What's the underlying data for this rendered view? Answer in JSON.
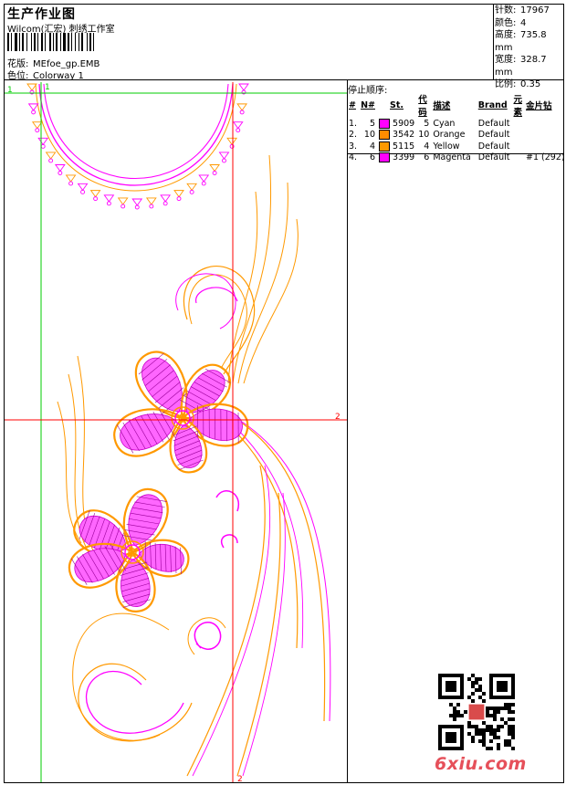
{
  "header": {
    "title": "生产作业图",
    "company": "Wilcom(汇宏) 刺绣工作室"
  },
  "design_info": {
    "name_label": "花版:",
    "name_value": "MEfoe_gp.EMB",
    "colorway_label": "色位:",
    "colorway_value": "Colorway 1"
  },
  "stats": {
    "stitches_label": "针数:",
    "stitches_value": "17967",
    "colors_label": "颜色:",
    "colors_value": "4",
    "height_label": "高度:",
    "height_value": "735.8 mm",
    "width_label": "宽度:",
    "width_value": "328.7 mm",
    "scale_label": "比例:",
    "scale_value": "0.35"
  },
  "stop_sequence": {
    "title": "停止顺序:",
    "headers": [
      "#",
      "N#",
      "St.",
      "代码",
      "描述",
      "Brand",
      "元素",
      "金片钻"
    ],
    "rows": [
      {
        "idx": "1.",
        "n": "5",
        "color": "#ff00ff",
        "st": "5909",
        "code": "5",
        "desc": "Cyan",
        "brand": "Default",
        "elem": "",
        "seq": ""
      },
      {
        "idx": "2.",
        "n": "10",
        "color": "#ff8c00",
        "st": "3542",
        "code": "10",
        "desc": "Orange",
        "brand": "Default",
        "elem": "",
        "seq": ""
      },
      {
        "idx": "3.",
        "n": "4",
        "color": "#ff9900",
        "st": "5115",
        "code": "4",
        "desc": "Yellow",
        "brand": "Default",
        "elem": "",
        "seq": ""
      },
      {
        "idx": "4.",
        "n": "6",
        "color": "#ff00ff",
        "st": "3399",
        "code": "6",
        "desc": "Magenta",
        "brand": "Default",
        "elem": "",
        "seq": "#1 (292)"
      }
    ]
  },
  "guides": {
    "left_num": "1",
    "top_num": "1",
    "right_num": "2",
    "bottom_num": "2"
  },
  "watermark": "6xiu.com",
  "colors": {
    "magenta": "#ff00ff",
    "orange": "#ff9900",
    "guide_green": "#00cc00",
    "guide_red": "#ff0000"
  }
}
